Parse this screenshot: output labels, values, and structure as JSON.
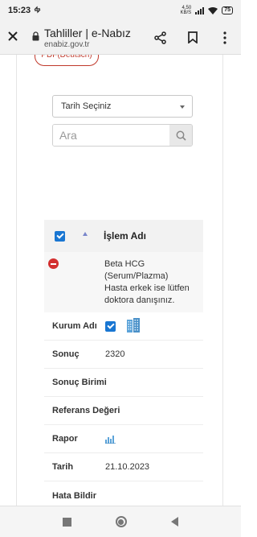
{
  "status_bar": {
    "time": "15:23",
    "network_speed": "4,50",
    "network_unit": "KB/S",
    "battery": "75"
  },
  "browser": {
    "title": "Tahliller | e-Nabız",
    "url": "enabiz.gov.tr"
  },
  "page": {
    "pdf_button_label": "PDF(Deutsch)",
    "date_select": {
      "selected": "Tarih Seçiniz"
    },
    "search": {
      "placeholder": "Ara"
    },
    "table": {
      "header_label": "İşlem Adı",
      "row": {
        "test_name_line1": "Beta HCG",
        "test_name_line2": "(Serum/Plazma)",
        "test_name_line3": "Hasta erkek ise lütfen",
        "test_name_line4": "doktora danışınız."
      },
      "details": {
        "institution_label": "Kurum Adı",
        "result_label": "Sonuç",
        "result_value": "2320",
        "unit_label": "Sonuç Birimi",
        "reference_label": "Referans Değeri",
        "report_label": "Rapor",
        "date_label": "Tarih",
        "date_value": "21.10.2023",
        "report_error_label": "Hata Bildir"
      }
    }
  },
  "colors": {
    "accent_blue": "#1976d2",
    "danger_red": "#d32f2f",
    "pdf_red": "#c0392b"
  },
  "icons": {
    "close": "close-icon",
    "lock": "lock-icon",
    "share": "share-icon",
    "bookmark": "bookmark-icon",
    "search": "search-icon",
    "building": "building-icon",
    "chart": "chart-icon"
  }
}
